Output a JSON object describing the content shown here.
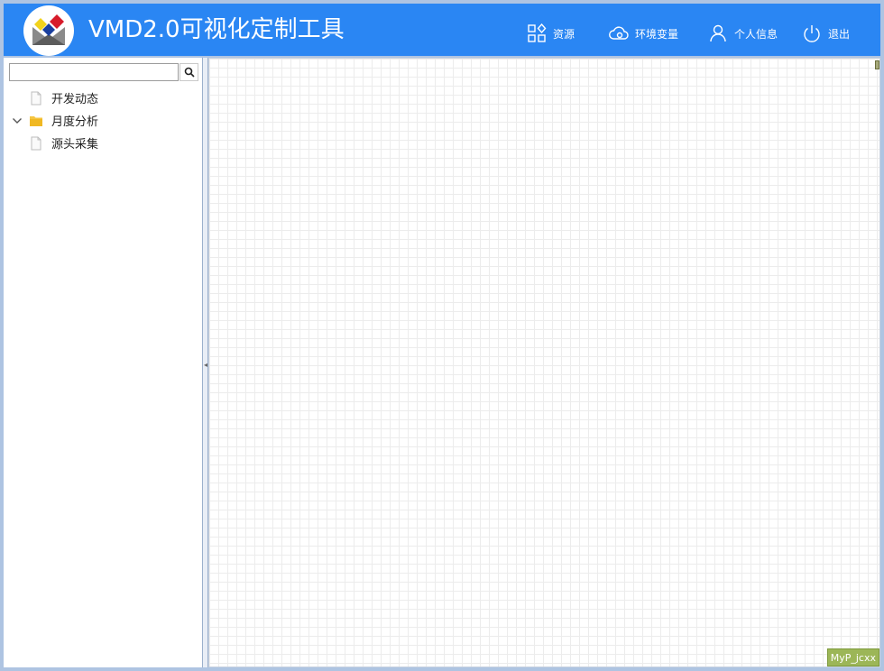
{
  "header": {
    "title": "VMD2.0可视化定制工具",
    "logo_icon": "vmd-logo-icon",
    "nav": [
      {
        "label": "资源",
        "icon": "resources-grid-icon"
      },
      {
        "label": "环境变量",
        "icon": "cloud-gear-icon"
      },
      {
        "label": "个人信息",
        "icon": "user-icon"
      },
      {
        "label": "退出",
        "icon": "power-icon"
      }
    ]
  },
  "sidebar": {
    "search": {
      "value": "",
      "placeholder": ""
    },
    "tree": [
      {
        "label": "开发动态",
        "type": "file",
        "expandable": false
      },
      {
        "label": "月度分析",
        "type": "folder",
        "expandable": true,
        "expanded": true
      },
      {
        "label": "源头采集",
        "type": "file",
        "expandable": false
      }
    ]
  },
  "canvas": {
    "tag_label": "MyP_jcxx"
  },
  "colors": {
    "header_bg": "#2a86f3",
    "folder": "#f5c542",
    "tag_bg": "#9cb657"
  }
}
